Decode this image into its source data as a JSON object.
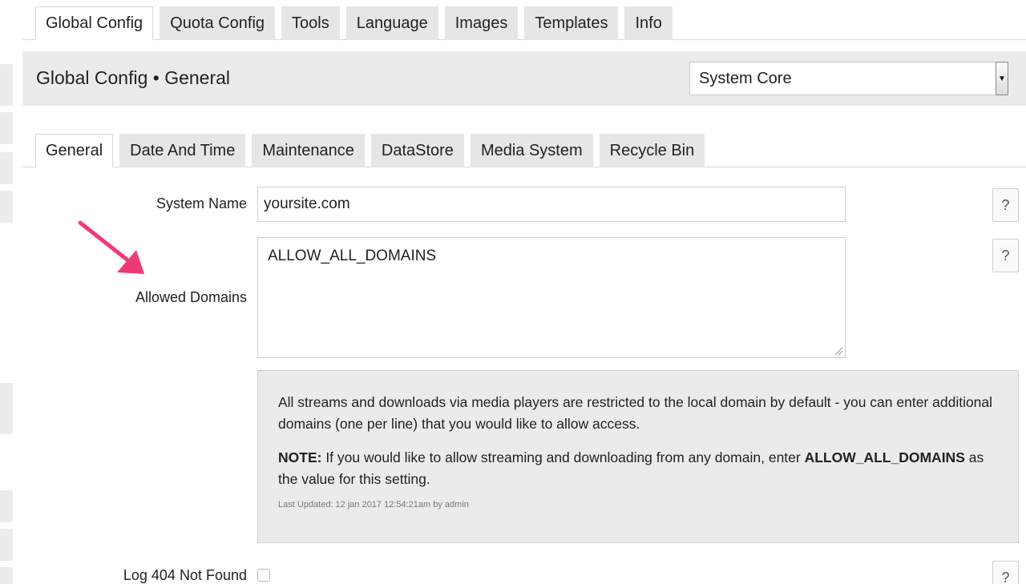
{
  "top_tabs": [
    {
      "label": "Global Config",
      "active": true
    },
    {
      "label": "Quota Config",
      "active": false
    },
    {
      "label": "Tools",
      "active": false
    },
    {
      "label": "Language",
      "active": false
    },
    {
      "label": "Images",
      "active": false
    },
    {
      "label": "Templates",
      "active": false
    },
    {
      "label": "Info",
      "active": false
    }
  ],
  "header": {
    "title": "Global Config • General",
    "select_value": "System Core"
  },
  "sub_tabs": [
    {
      "label": "General",
      "active": true
    },
    {
      "label": "Date And Time",
      "active": false
    },
    {
      "label": "Maintenance",
      "active": false
    },
    {
      "label": "DataStore",
      "active": false
    },
    {
      "label": "Media System",
      "active": false
    },
    {
      "label": "Recycle Bin",
      "active": false
    }
  ],
  "form": {
    "system_name_label": "System Name",
    "system_name_value": "yoursite.com",
    "allowed_domains_label": "Allowed Domains",
    "allowed_domains_value": "ALLOW_ALL_DOMAINS",
    "help_label": "?",
    "info": {
      "text": "All streams and downloads via media players are restricted to the local domain by default - you can enter additional domains (one per line) that you would like to allow access.",
      "note_prefix": "NOTE:",
      "note_text": " If you would like to allow streaming and downloading from any domain, enter ",
      "note_value": "ALLOW_ALL_DOMAINS",
      "note_suffix": " as the value for this setting.",
      "last_updated": "Last Updated: 12 jan 2017 12:54:21am by admin"
    },
    "log404_label": "Log 404 Not Found",
    "log404_checked": false
  },
  "colors": {
    "arrow": "#f03a78",
    "tab_bg": "#e6e6e6",
    "header_bg": "#ebebeb"
  }
}
